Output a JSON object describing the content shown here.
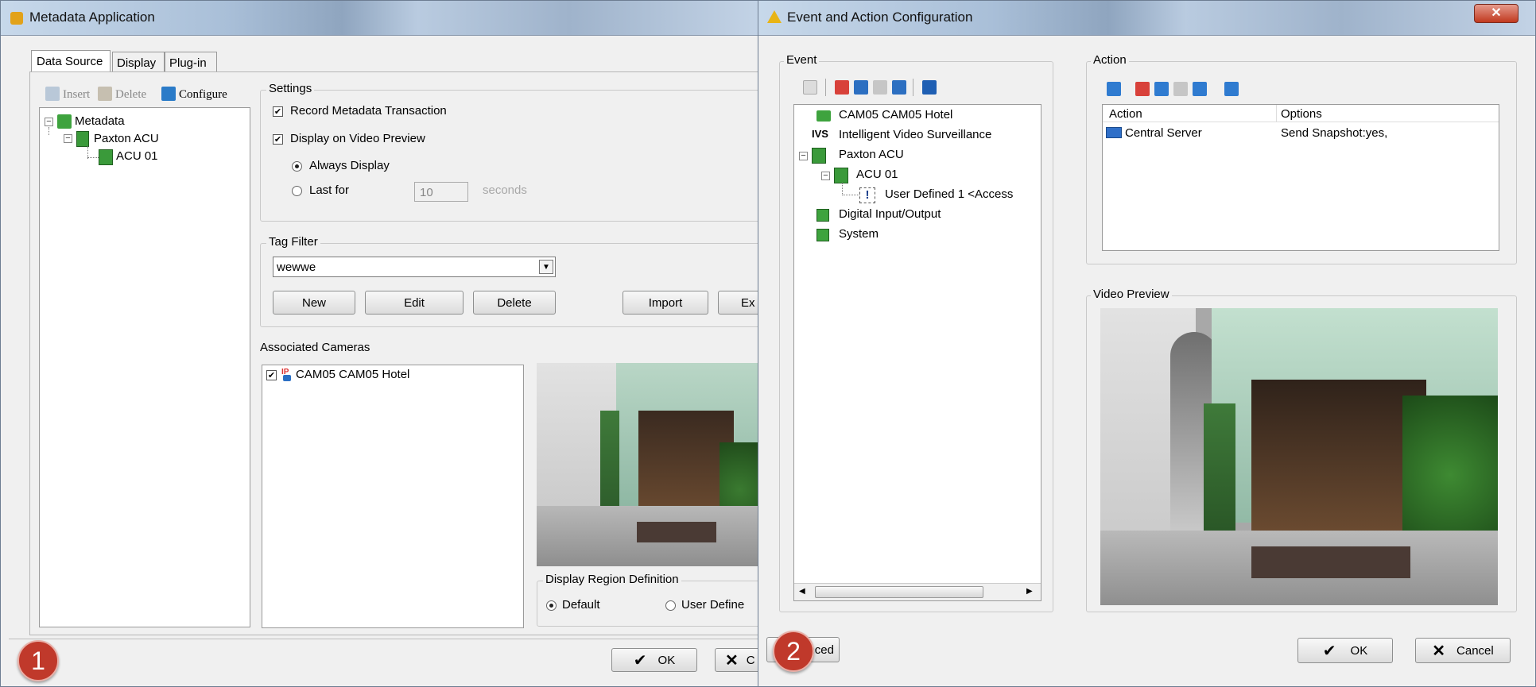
{
  "window1": {
    "title": "Metadata Application",
    "tabs": [
      "Data Source",
      "Display",
      "Plug-in"
    ],
    "toolbar": {
      "insert": "Insert",
      "delete": "Delete",
      "configure": "Configure"
    },
    "tree": {
      "root": "Metadata",
      "child": "Paxton ACU",
      "leaf": "ACU 01"
    },
    "settings": {
      "legend": "Settings",
      "record_metadata": "Record Metadata Transaction",
      "display_on_preview": "Display on Video Preview",
      "always_display": "Always Display",
      "last_for": "Last for",
      "last_for_value": "10",
      "seconds": "seconds"
    },
    "tag_filter": {
      "legend": "Tag Filter",
      "selected": "wewwe",
      "buttons": {
        "new": "New",
        "edit": "Edit",
        "delete": "Delete",
        "import": "Import",
        "export": "Ex"
      }
    },
    "associated_cameras": {
      "label": "Associated Cameras",
      "items": [
        "CAM05 CAM05 Hotel"
      ]
    },
    "display_region": {
      "legend": "Display Region Definition",
      "default": "Default",
      "user_define": "User Define"
    },
    "ok": "OK",
    "cancel_partial": "C"
  },
  "window2": {
    "title": "Event and Action Configuration",
    "event_legend": "Event",
    "event_tree": {
      "cam": "CAM05 CAM05 Hotel",
      "ivs": "Intelligent Video Surveillance",
      "paxton": "Paxton ACU",
      "acu": "ACU 01",
      "user_defined": "User Defined 1 <Access",
      "digital": "Digital Input/Output",
      "system": "System"
    },
    "action_legend": "Action",
    "action_table": {
      "headers": [
        "Action",
        "Options"
      ],
      "rows": [
        {
          "action": "Central Server",
          "options": "Send Snapshot:yes,"
        }
      ]
    },
    "video_preview_legend": "Video Preview",
    "advanced_partial": "anced",
    "ok": "OK",
    "cancel": "Cancel"
  },
  "badges": [
    "1",
    "2"
  ],
  "colors": {
    "badge": "#c0392b",
    "window_bg": "#f0f0f0",
    "title_bar": "#a9bfd8"
  }
}
